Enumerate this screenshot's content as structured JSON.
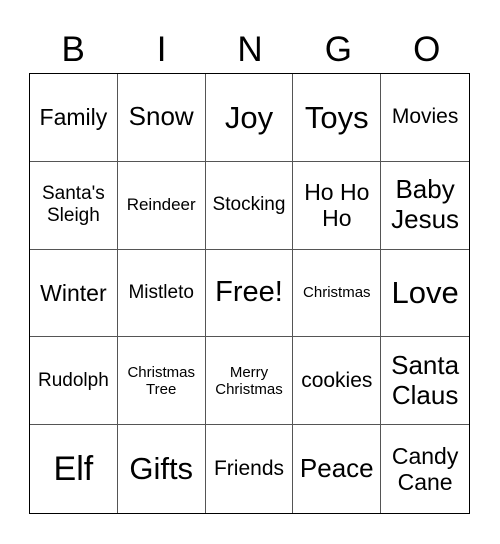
{
  "header": {
    "letters": [
      "B",
      "I",
      "N",
      "G",
      "O"
    ]
  },
  "cells": [
    [
      "Family",
      "Snow",
      "Joy",
      "Toys",
      "Movies"
    ],
    [
      "Santa's Sleigh",
      "Reindeer",
      "Stocking",
      "Ho Ho Ho",
      "Baby Jesus"
    ],
    [
      "Winter",
      "Mistleto",
      "Free!",
      "Christmas",
      "Love"
    ],
    [
      "Rudolph",
      "Christmas Tree",
      "Merry Christmas",
      "cookies",
      "Santa Claus"
    ],
    [
      "Elf",
      "Gifts",
      "Friends",
      "Peace",
      "Candy Cane"
    ]
  ]
}
